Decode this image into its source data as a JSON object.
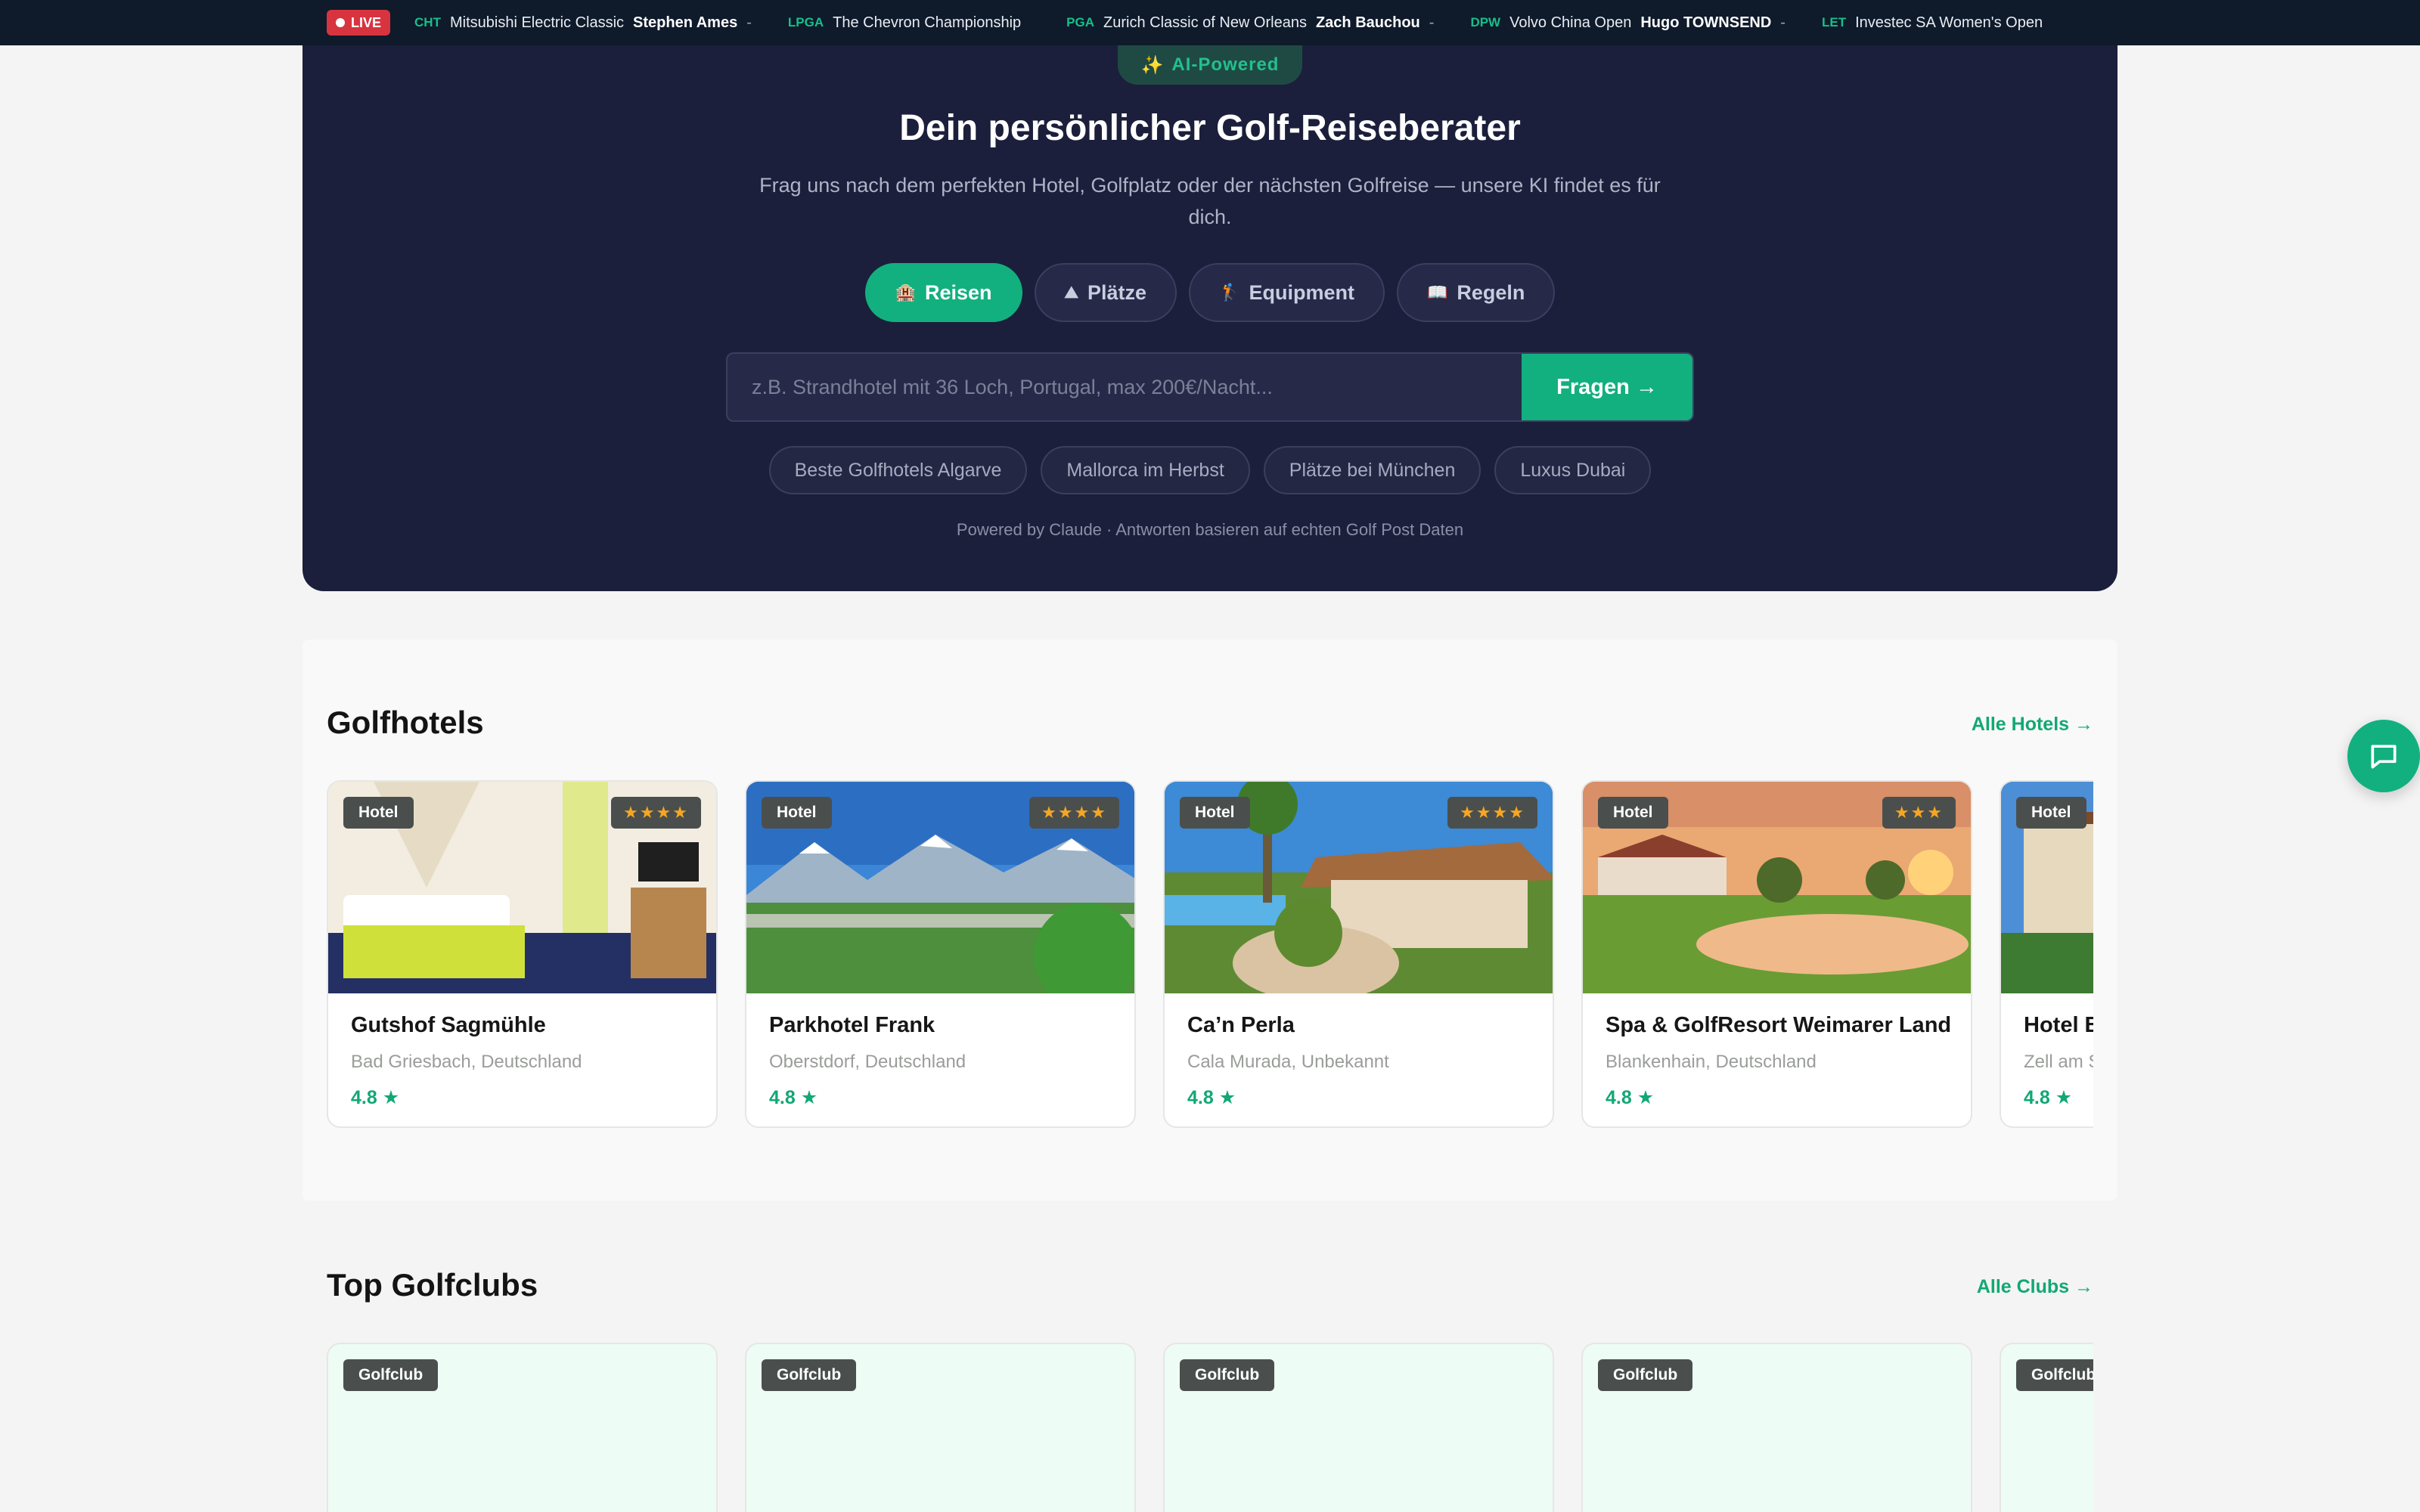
{
  "ticker": {
    "live_label": "LIVE",
    "items": [
      {
        "tour": "CHT",
        "event": "Mitsubishi Electric Classic",
        "player": "Stephen Ames",
        "score": "-"
      },
      {
        "tour": "LPGA",
        "event": "The Chevron Championship",
        "player": "",
        "score": ""
      },
      {
        "tour": "PGA",
        "event": "Zurich Classic of New Orleans",
        "player": "Zach Bauchou",
        "score": "-"
      },
      {
        "tour": "DPW",
        "event": "Volvo China Open",
        "player": "Hugo TOWNSEND",
        "score": "-"
      },
      {
        "tour": "LET",
        "event": "Investec SA Women's Open",
        "player": "",
        "score": ""
      }
    ]
  },
  "hero": {
    "ai_badge": "AI-Powered",
    "ai_badge_icon": "✨",
    "title": "Dein persönlicher Golf-Reiseberater",
    "subtitle": "Frag uns nach dem perfekten Hotel, Golfplatz oder der nächsten Golfreise — unsere KI findet es für dich.",
    "tabs": [
      {
        "icon": "🏨",
        "label": "Reisen",
        "active": true
      },
      {
        "icon": "⛰",
        "label": "Plätze",
        "active": false
      },
      {
        "icon": "🏌",
        "label": "Equipment",
        "active": false
      },
      {
        "icon": "📖",
        "label": "Regeln",
        "active": false
      }
    ],
    "search_placeholder": "z.B. Strandhotel mit 36 Loch, Portugal, max 200€/Nacht...",
    "search_button": "Fragen →",
    "suggestions": [
      "Beste Golfhotels Algarve",
      "Mallorca im Herbst",
      "Plätze bei München",
      "Luxus Dubai"
    ],
    "powered_by": "Powered by Claude · Antworten basieren auf echten Golf Post Daten"
  },
  "hotels": {
    "title": "Golfhotels",
    "link": "Alle Hotels →",
    "items": [
      {
        "badge": "Hotel",
        "stars": "★★★★",
        "name": "Gutshof Sagmühle",
        "location": "Bad Griesbach, Deutschland",
        "rating": "4.8 ★"
      },
      {
        "badge": "Hotel",
        "stars": "★★★★",
        "name": "Parkhotel Frank",
        "location": "Oberstdorf, Deutschland",
        "rating": "4.8 ★"
      },
      {
        "badge": "Hotel",
        "stars": "★★★★",
        "name": "Ca’n Perla",
        "location": "Cala Murada, Unbekannt",
        "rating": "4.8 ★"
      },
      {
        "badge": "Hotel",
        "stars": "★★★",
        "name": "Spa & GolfResort Weimarer Land",
        "location": "Blankenhain, Deutschland",
        "rating": "4.8 ★"
      },
      {
        "badge": "Hotel",
        "stars": "",
        "name": "Hotel B",
        "location": "Zell am S",
        "rating": "4.8 ★"
      }
    ]
  },
  "clubs": {
    "title": "Top Golfclubs",
    "link": "Alle Clubs →",
    "items": [
      {
        "badge": "Golfclub"
      },
      {
        "badge": "Golfclub"
      },
      {
        "badge": "Golfclub"
      },
      {
        "badge": "Golfclub"
      },
      {
        "badge": "Golfclub"
      }
    ]
  },
  "colors": {
    "accent": "#12b07f",
    "hero_bg": "#1b1f3b",
    "ticker_bg": "#0f1a2b",
    "live_red": "#d8343f",
    "star_gold": "#f6a623"
  },
  "icons": {
    "chat": "chat-icon"
  }
}
